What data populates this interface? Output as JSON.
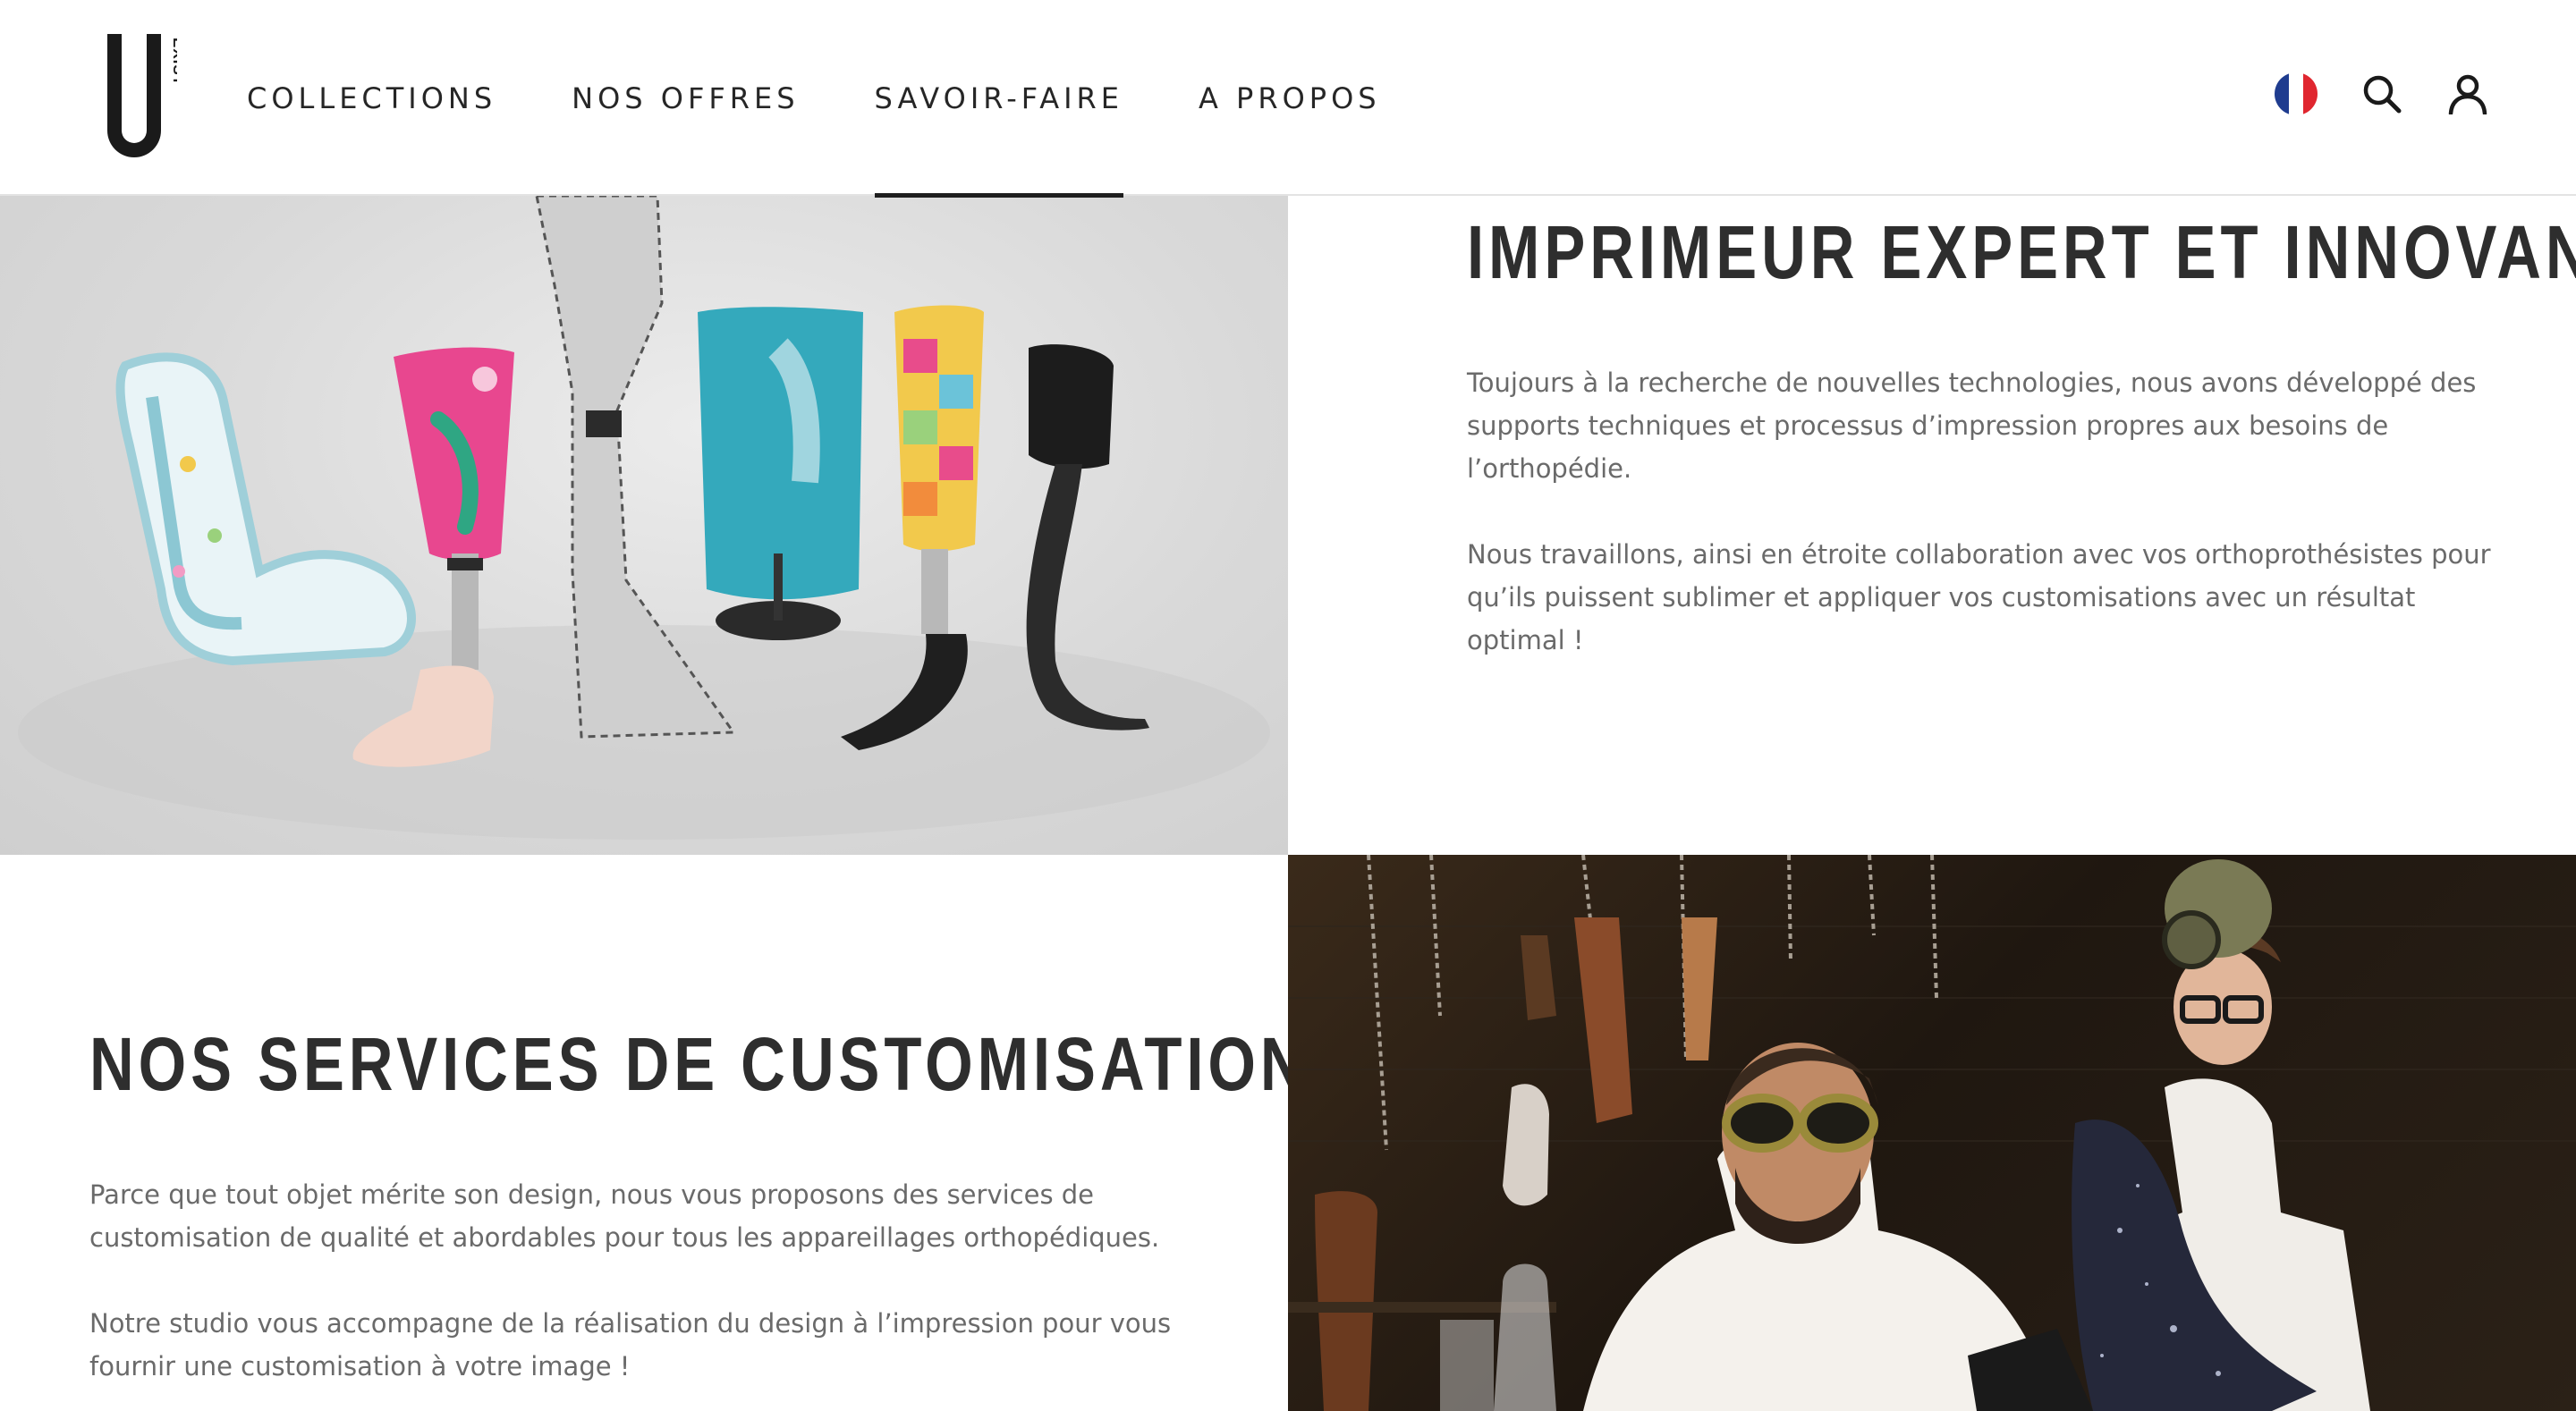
{
  "header": {
    "logo": {
      "main_letter": "U",
      "side_text": "EXIST"
    },
    "nav": [
      {
        "label": "COLLECTIONS",
        "active": false
      },
      {
        "label": "NOS OFFRES",
        "active": false
      },
      {
        "label": "SAVOIR-FAIRE",
        "active": true
      },
      {
        "label": "A PROPOS",
        "active": false
      }
    ],
    "icons": [
      "france-flag-icon",
      "search-icon",
      "user-icon"
    ]
  },
  "section_printer": {
    "title": "IMPRIMEUR EXPERT ET INNOVANT",
    "paragraphs": [
      "Toujours à la recherche de nouvelles technologies, nous avons développé des supports techniques et processus d’impression propres aux besoins de l’orthopédie.",
      "Nous travaillons, ainsi en étroite collaboration avec vos orthoprothésistes pour qu’ils puissent sublimer et appliquer vos customisations avec un résultat optimal !"
    ]
  },
  "section_customisation": {
    "title": "NOS SERVICES DE CUSTOMISATION",
    "paragraphs": [
      "Parce que tout objet mérite son design, nous vous proposons des services de customisation de qualité et abordables pour tous les appareillages orthopédiques.",
      "Notre studio vous accompagne de la réalisation du design à l’impression pour vous fournir une customisation à votre image !"
    ]
  },
  "colors": {
    "text_dark": "#2e2e2e",
    "text_body": "#6a6a6a",
    "flag_blue": "#1f3c8f",
    "flag_red": "#e0262f"
  }
}
